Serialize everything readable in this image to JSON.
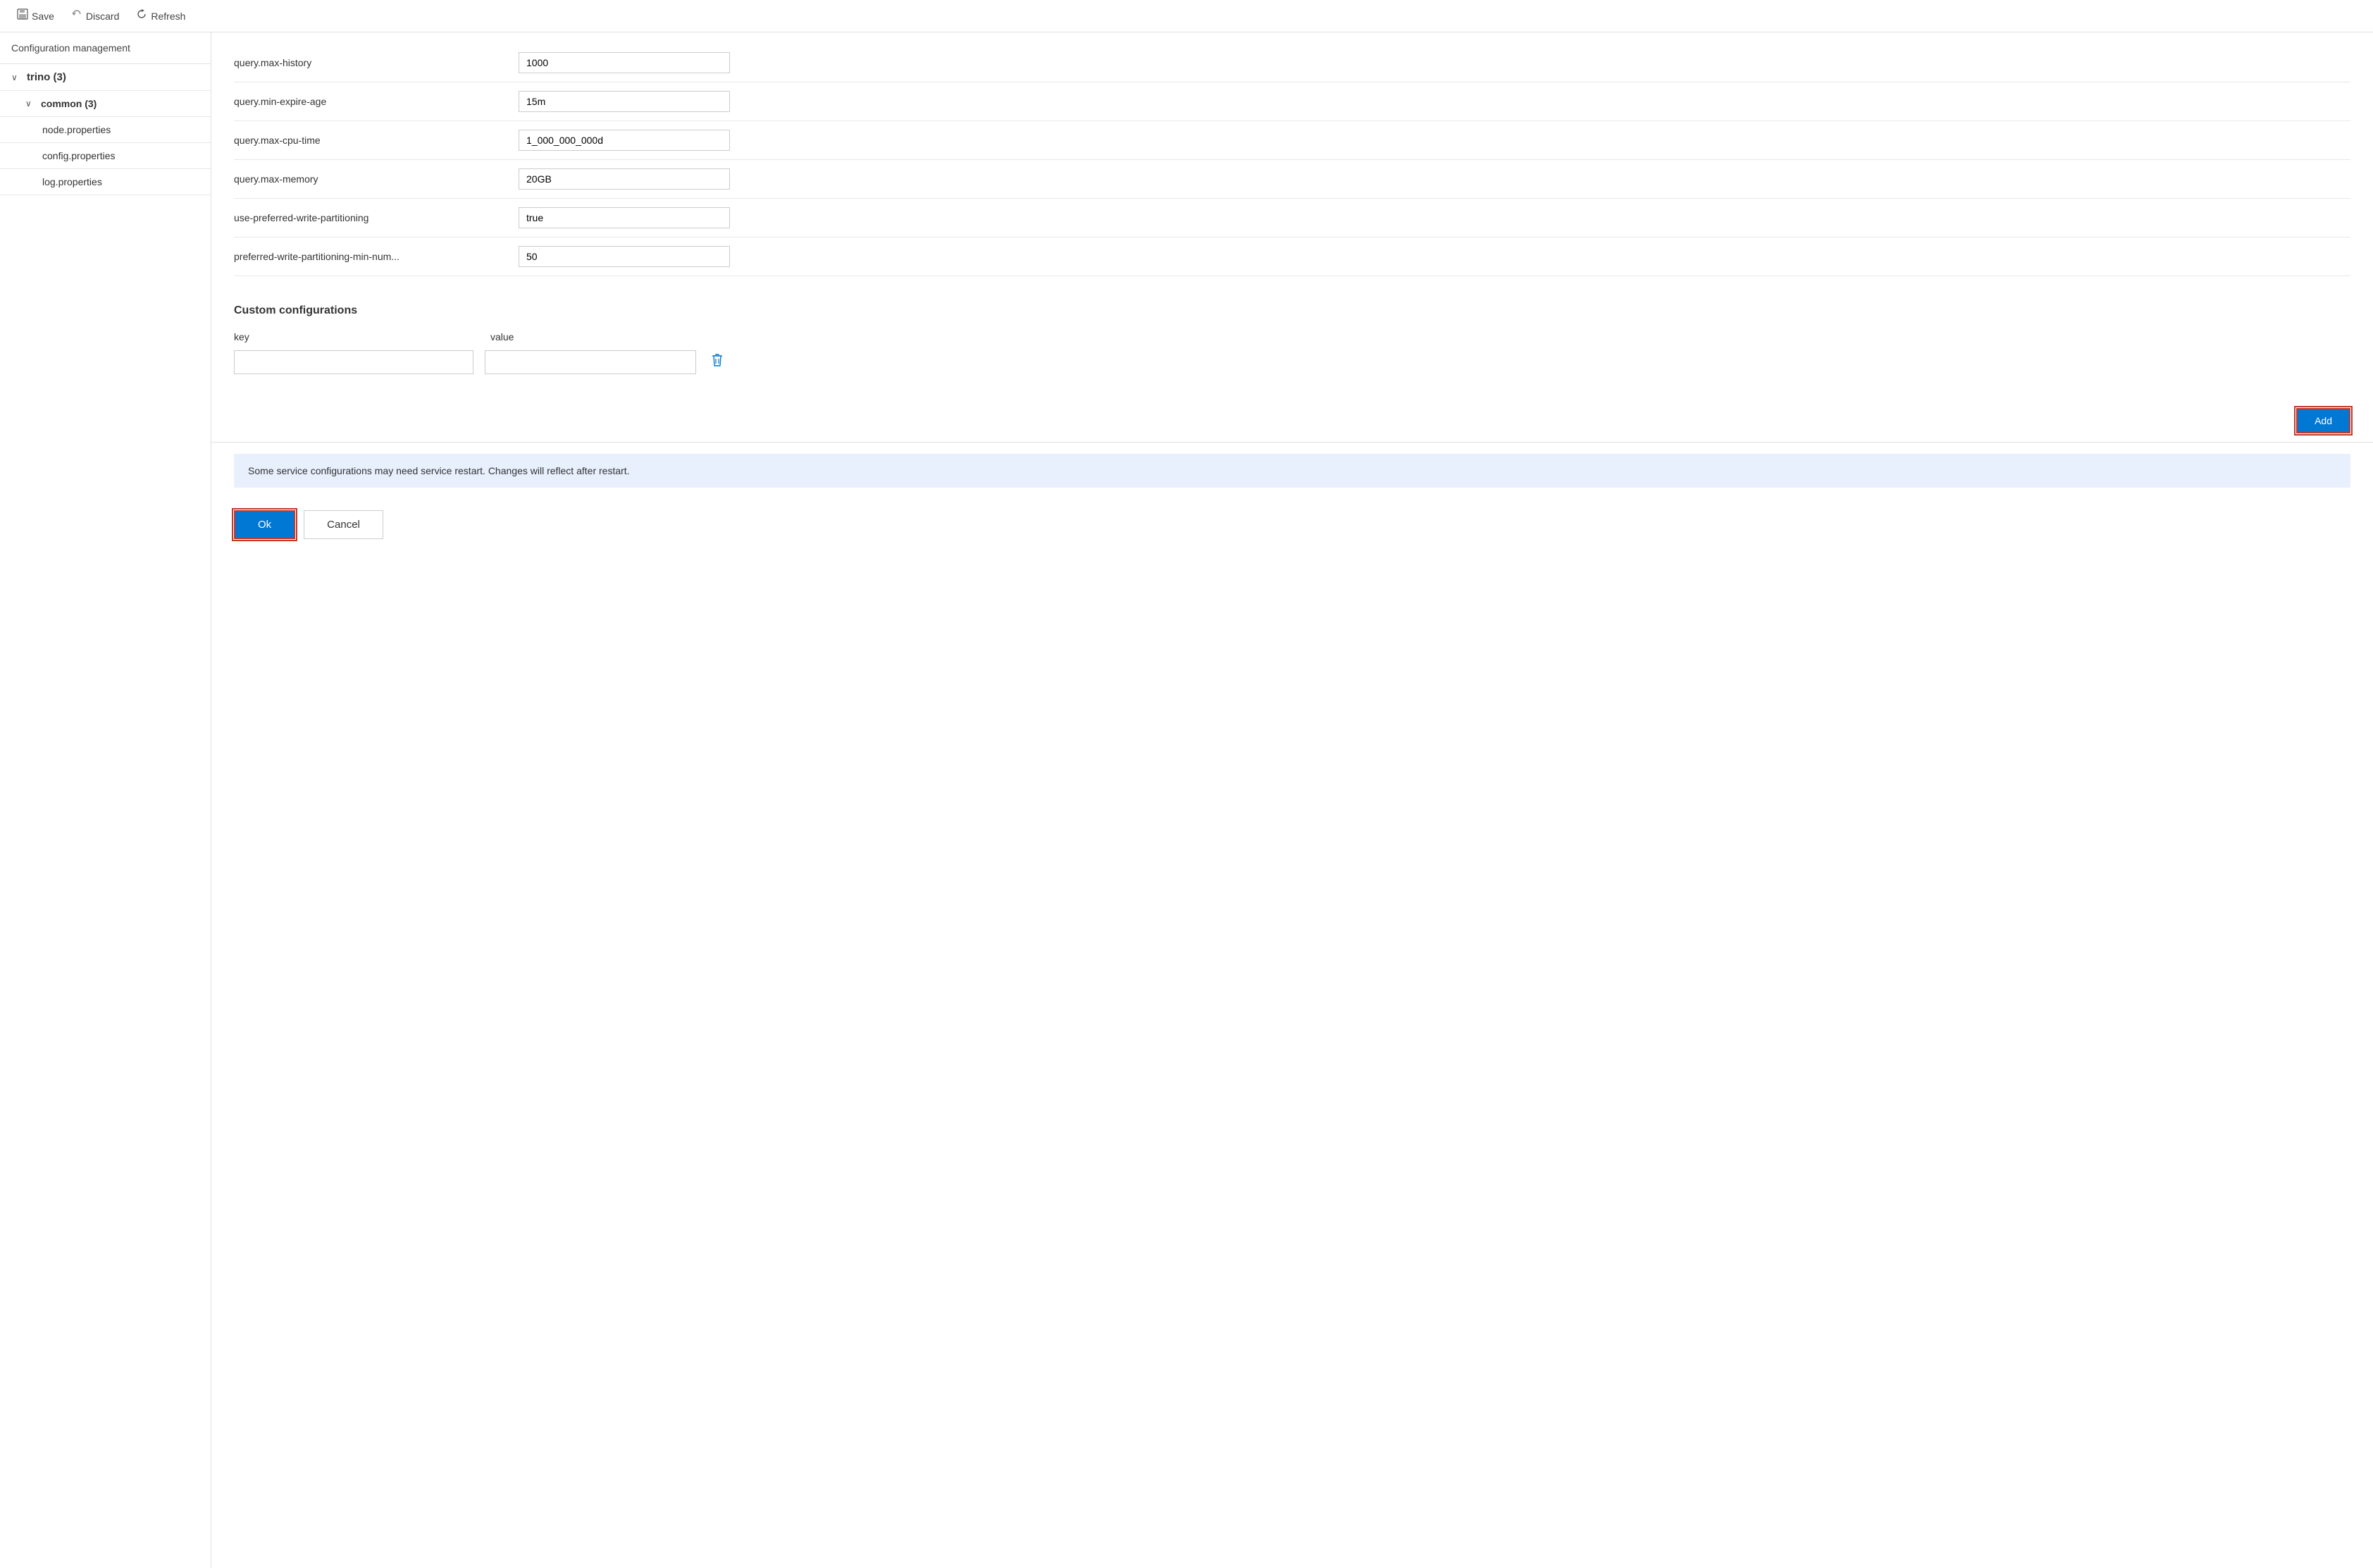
{
  "toolbar": {
    "save_label": "Save",
    "discard_label": "Discard",
    "refresh_label": "Refresh"
  },
  "sidebar": {
    "title": "Configuration management",
    "tree": {
      "root_label": "trino (3)",
      "root_count": "3",
      "child_label": "common (3)",
      "child_count": "3",
      "leaves": [
        "node.properties",
        "config.properties",
        "log.properties"
      ]
    }
  },
  "config_rows": [
    {
      "key": "query.max-history",
      "value": "1000"
    },
    {
      "key": "query.min-expire-age",
      "value": "15m"
    },
    {
      "key": "query.max-cpu-time",
      "value": "1_000_000_000d"
    },
    {
      "key": "query.max-memory",
      "value": "20GB"
    },
    {
      "key": "use-preferred-write-partitioning",
      "value": "true"
    },
    {
      "key": "preferred-write-partitioning-min-num...",
      "value": "50"
    }
  ],
  "custom_configs": {
    "title": "Custom configurations",
    "key_header": "key",
    "value_header": "value",
    "key_placeholder": "",
    "value_placeholder": "",
    "add_label": "Add"
  },
  "info_banner": {
    "text": "Some service configurations may need service restart. Changes will reflect after restart."
  },
  "footer": {
    "ok_label": "Ok",
    "cancel_label": "Cancel"
  }
}
